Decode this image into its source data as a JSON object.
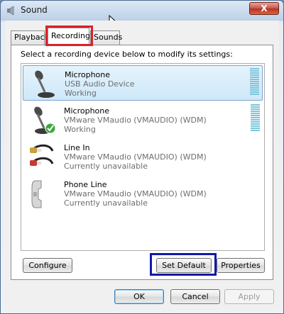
{
  "window": {
    "title": "Sound",
    "close_label": "X"
  },
  "tabs": [
    {
      "label": "Playback",
      "active": false
    },
    {
      "label": "Recording",
      "active": true
    },
    {
      "label": "Sounds",
      "active": false
    }
  ],
  "panel": {
    "instructions": "Select a recording device below to modify its settings:",
    "devices": [
      {
        "name": "Microphone",
        "description": "USB Audio Device",
        "status": "Working",
        "icon": "microphone-icon",
        "selected": true,
        "level_meter": true
      },
      {
        "name": "Microphone",
        "description": "VMware VMaudio (VMAUDIO) (WDM)",
        "status": "Working",
        "icon": "microphone-default-icon",
        "selected": false,
        "level_meter": true
      },
      {
        "name": "Line In",
        "description": "VMware VMaudio (VMAUDIO) (WDM)",
        "status": "Currently unavailable",
        "icon": "line-in-cable-icon",
        "selected": false,
        "level_meter": false
      },
      {
        "name": "Phone Line",
        "description": "VMware VMaudio (VMAUDIO) (WDM)",
        "status": "Currently unavailable",
        "icon": "phone-handset-icon",
        "selected": false,
        "level_meter": false
      }
    ],
    "buttons": {
      "configure": "Configure",
      "set_default": "Set Default",
      "properties": "Properties"
    }
  },
  "footer": {
    "ok": "OK",
    "cancel": "Cancel",
    "apply": "Apply"
  },
  "colors": {
    "tab_highlight": "#d9222a",
    "set_default_highlight": "#1219a8",
    "selection": "#cde8f9"
  }
}
